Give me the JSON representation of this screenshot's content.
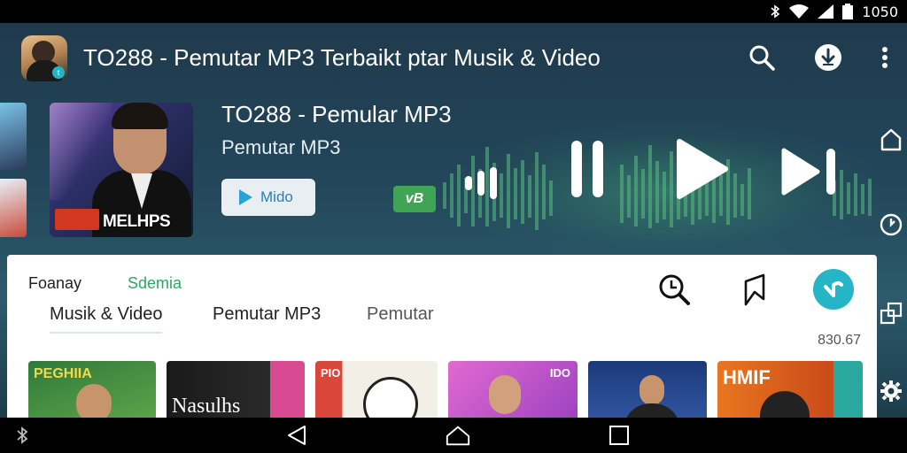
{
  "status_bar": {
    "time": "1050",
    "icons": [
      "bluetooth-icon",
      "wifi-icon",
      "signal-icon",
      "battery-icon"
    ]
  },
  "header": {
    "title": "TO288 - Pemutar MP3 Terbaikt ptar Musik & Video",
    "app_icon_badge": "t",
    "actions": [
      "search-icon",
      "download-icon",
      "more-vert-icon"
    ]
  },
  "now_playing": {
    "title": "TO288 - Pemular MP3",
    "subtitle": "Pemutar MP3",
    "album_caption": "MELHPS",
    "video_button_label": "Mido",
    "badge_text": "vB",
    "controls": [
      "volume-icon",
      "pause-icon",
      "play-icon",
      "skip-next-icon"
    ]
  },
  "side_rail": [
    "home-icon",
    "clock-icon",
    "overlap-icon",
    "settings-icon"
  ],
  "panel": {
    "chips": [
      {
        "label": "Foanay",
        "color": "#222222"
      },
      {
        "label": "Sdemia",
        "color": "#2aa866"
      }
    ],
    "tabs": [
      {
        "label": "Musik & Video",
        "active": true
      },
      {
        "label": "Pemutar MP3",
        "active": false
      },
      {
        "label": "Pemutar",
        "active": false
      }
    ],
    "count": "830.67",
    "actions": [
      "history-search-icon",
      "bookmark-icon",
      "teal-action-icon"
    ],
    "tiles": [
      {
        "caption": "PEGHIIA",
        "palette": [
          "#2f7a3a",
          "#63a84c"
        ]
      },
      {
        "caption": "Nasulhs",
        "palette": [
          "#1a1a1a",
          "#d94a94"
        ]
      },
      {
        "caption": "PIO",
        "palette": [
          "#f2efe6",
          "#d9463a"
        ]
      },
      {
        "caption": "IDO",
        "palette": [
          "#b14fc7",
          "#e06ad0"
        ]
      },
      {
        "caption": "",
        "palette": [
          "#1b3a7a",
          "#355aa8"
        ]
      },
      {
        "caption": "HMIF",
        "palette": [
          "#e8761f",
          "#2aa8a0"
        ]
      }
    ]
  },
  "navbar": [
    "back-icon",
    "home-nav-icon",
    "recents-icon"
  ],
  "colors": {
    "accent_teal": "#25b5c6",
    "accent_green": "#3fa554",
    "header_bg": "#1f3a4c"
  }
}
